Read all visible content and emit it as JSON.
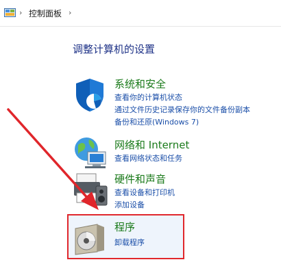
{
  "address_bar": {
    "breadcrumb": "控制面板",
    "icon": "control-panel-icon",
    "separator": "chevron-right-icon"
  },
  "page_title": "调整计算机的设置",
  "categories": [
    {
      "title": "系统和安全",
      "icon": "shield-icon",
      "links": [
        "查看你的计算机状态",
        "通过文件历史记录保存你的文件备份副本",
        "备份和还原(Windows 7)"
      ]
    },
    {
      "title": "网络和 Internet",
      "icon": "network-globe-icon",
      "links": [
        "查看网络状态和任务"
      ]
    },
    {
      "title": "硬件和声音",
      "icon": "printer-speaker-icon",
      "links": [
        "查看设备和打印机",
        "添加设备"
      ]
    },
    {
      "title": "程序",
      "icon": "programs-disc-icon",
      "links": [
        "卸载程序"
      ]
    }
  ],
  "colors": {
    "title_blue": "#1e3287",
    "category_green": "#1a7a1a",
    "link_blue": "#1a4ea8",
    "highlight_red": "#e0262b",
    "arrow_red": "#e0262b"
  }
}
